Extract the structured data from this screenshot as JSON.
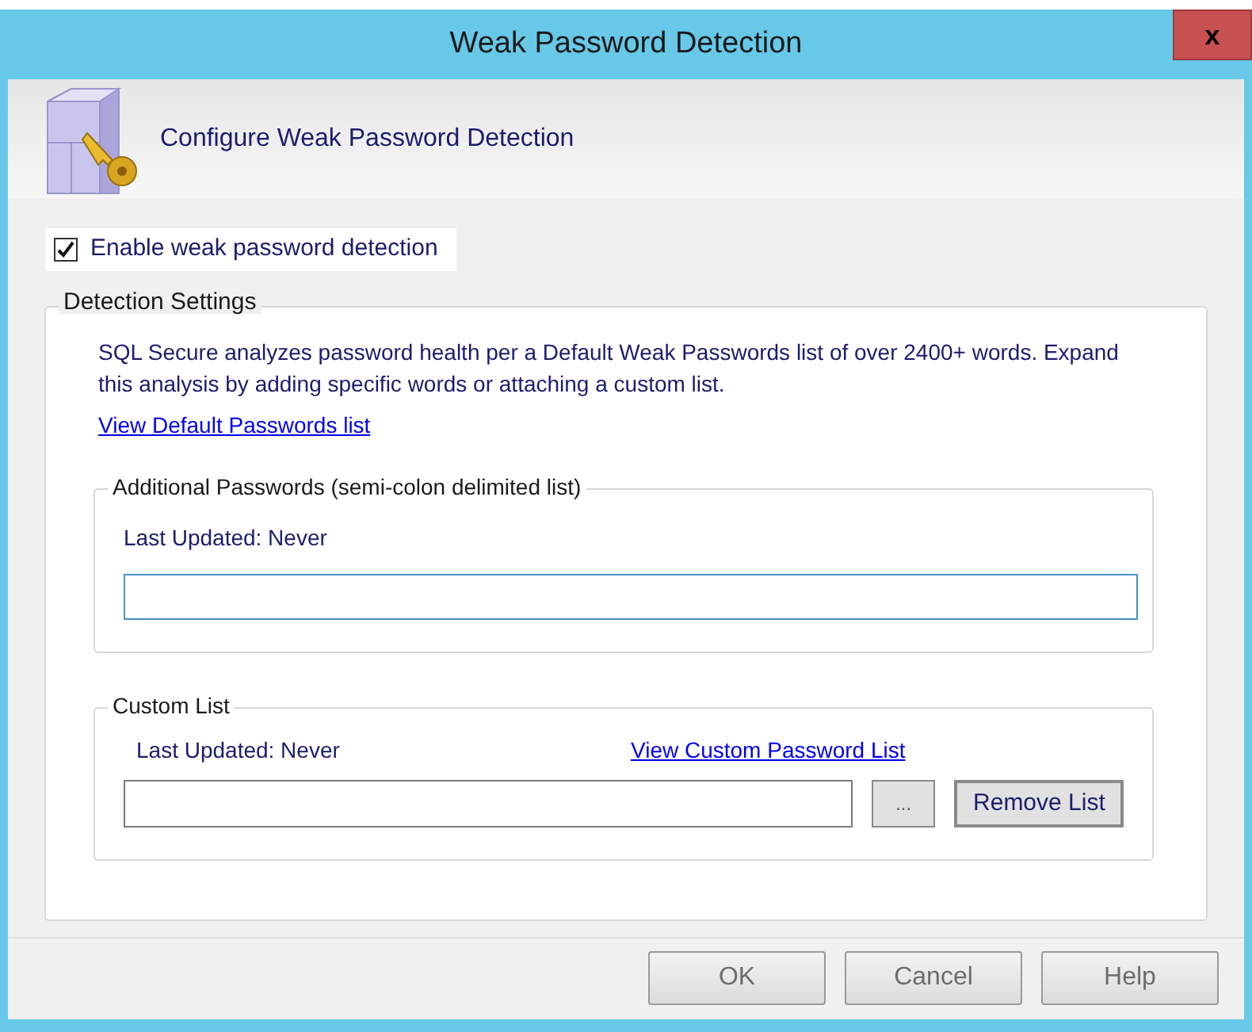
{
  "window": {
    "title": "Weak Password Detection",
    "close": "x"
  },
  "header": {
    "title": "Configure Weak Password Detection"
  },
  "enable_checkbox": {
    "label": "Enable weak password detection",
    "checked": true
  },
  "detection_settings": {
    "title": "Detection Settings",
    "description": "SQL Secure analyzes password health per a Default Weak Passwords list of over 2400+ words. Expand this analysis by adding specific words or attaching a custom list.",
    "link": "View Default Passwords list",
    "additional_passwords": {
      "title": "Additional Passwords (semi-colon delimited list)",
      "last_updated": "Last Updated: Never"
    },
    "custom_list": {
      "title": "Custom List",
      "last_updated": "Last Updated: Never",
      "link": "View Custom Password List",
      "browse_button": "...",
      "remove_button": "Remove List"
    }
  },
  "buttons": [
    "OK",
    "Cancel",
    "Help"
  ]
}
